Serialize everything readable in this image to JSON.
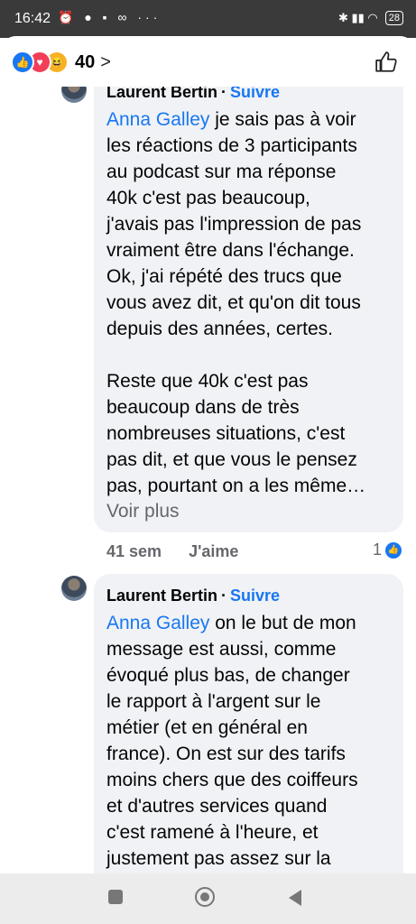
{
  "status_bar": {
    "time": "16:42",
    "left_icons": "⏰ ● ▪ ∞ ···",
    "right_icons": "✱ ▮▮ ◠",
    "battery": "28"
  },
  "header": {
    "reaction_count": "40",
    "reaction_icons": [
      "like-icon",
      "love-icon",
      "haha-icon"
    ]
  },
  "comments": [
    {
      "author": "Laurent Bertin",
      "separator": "·",
      "follow_label": "Suivre",
      "mention": "Anna Galley",
      "text": " je sais pas à voir\nles réactions de 3 participants\nau podcast sur ma réponse\n40k c'est pas beaucoup,\nj'avais pas l'impression de pas\nvraiment être dans l'échange.\nOk, j'ai répété des trucs que\nvous avez dit, et qu'on dit tous\ndepuis des années, certes.\n\nReste que 40k c'est pas\nbeaucoup dans de très\nnombreuses situations, c'est\npas dit, et que vous le pensez\npas, pourtant on a les même…",
      "see_more": "Voir plus",
      "time": "41 sem",
      "like_label": "J'aime",
      "likes": "1"
    },
    {
      "author": "Laurent Bertin",
      "separator": "·",
      "follow_label": "Suivre",
      "mention": "Anna Galley",
      "text": " on le but de mon\nmessage est aussi, comme\névoqué plus bas, de changer\nle rapport à l'argent sur le\nmétier (et en général en\nfrance). On est sur des tarifs\nmoins chers que des coiffeurs\net d'autres services quand\nc'est ramené à l'heure, et\njustement pas assez sur la"
    }
  ],
  "colors": {
    "accent": "#1877f2",
    "bubble": "#f0f2f5",
    "love": "#f33e58",
    "haha": "#f7b125"
  }
}
